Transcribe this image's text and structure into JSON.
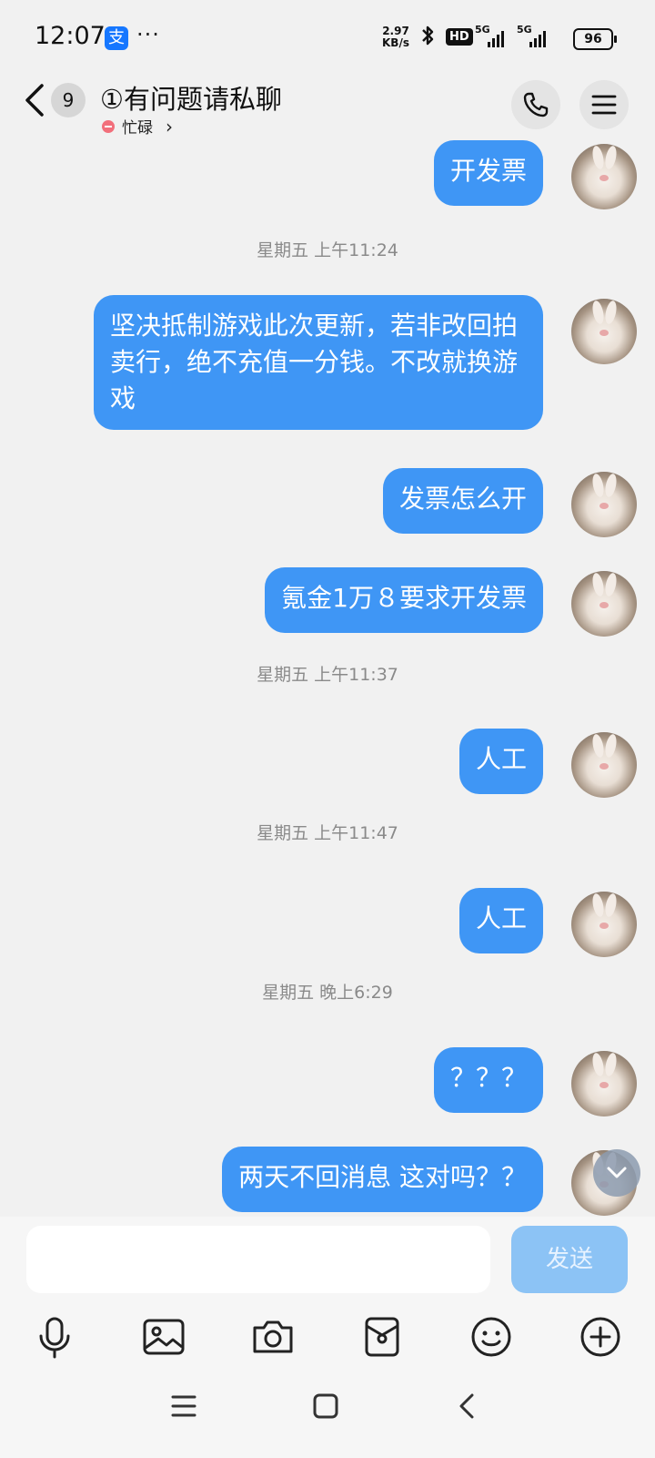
{
  "status_bar": {
    "time": "12:07",
    "app_icon_label": "支",
    "more_indicator": "···",
    "net_speed_value": "2.97",
    "net_speed_unit": "KB/s",
    "hd_label": "HD",
    "signal1_label": "5G",
    "signal2_label": "5G",
    "battery": "96"
  },
  "header": {
    "unread_count": "9",
    "title": "①有问题请私聊",
    "status": "忙碌",
    "status_arrow": "›"
  },
  "messages": [
    {
      "type": "bubble",
      "text": "开发票"
    },
    {
      "type": "time",
      "text": "星期五 上午11:24"
    },
    {
      "type": "bubble",
      "text": "坚决抵制游戏此次更新，若非改回拍卖行，绝不充值一分钱。不改就换游戏"
    },
    {
      "type": "bubble",
      "text": "发票怎么开"
    },
    {
      "type": "bubble",
      "text": "氪金1万８要求开发票"
    },
    {
      "type": "time",
      "text": "星期五 上午11:37"
    },
    {
      "type": "bubble",
      "text": "人工"
    },
    {
      "type": "time",
      "text": "星期五 上午11:47"
    },
    {
      "type": "bubble",
      "text": "人工"
    },
    {
      "type": "time",
      "text": "星期五 晚上6:29"
    },
    {
      "type": "bubble",
      "text": "？？？"
    },
    {
      "type": "bubble",
      "text": "两天不回消息 这对吗？？"
    }
  ],
  "input": {
    "value": "",
    "placeholder": "",
    "send_label": "发送"
  },
  "toolbar": [
    "mic-icon",
    "image-icon",
    "camera-icon",
    "red-packet-icon",
    "emoji-icon",
    "plus-icon"
  ],
  "navbar": [
    "menu-icon",
    "home-icon",
    "back-icon"
  ],
  "colors": {
    "bubble": "#3f96f5",
    "send_disabled": "#8cc3f5",
    "busy": "#f26f7b",
    "background": "#f1f1f1"
  }
}
